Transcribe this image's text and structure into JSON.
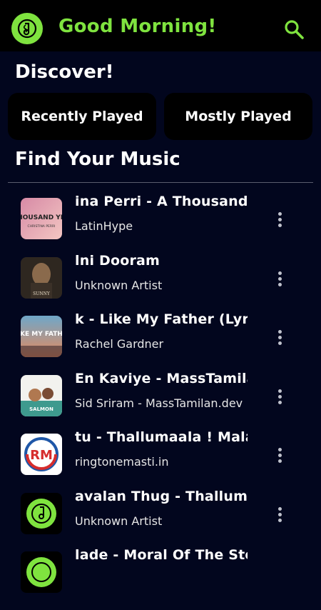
{
  "header": {
    "greeting": "Good Morning!",
    "logo_icon": "music-note-logo-icon",
    "search_icon": "search-icon",
    "accent_color": "#7fe33f"
  },
  "discover": {
    "heading": "Discover!",
    "tabs": [
      {
        "label": "Recently Played"
      },
      {
        "label": "Mostly Played"
      }
    ]
  },
  "library": {
    "heading": "Find Your Music",
    "songs": [
      {
        "title": "ina Perri - A Thousand Y",
        "artist": "LatinHype",
        "thumb_text": "THOUSAND YEA",
        "thumb_subtext": "CHRISTINA PERRI"
      },
      {
        "title": "lni Dooram",
        "artist": "Unknown Artist",
        "thumb_text": "SUNNY"
      },
      {
        "title": "k  - Like My Father (Lyric",
        "artist": "Rachel Gardner",
        "thumb_text": "KE MY FATH"
      },
      {
        "title": "En Kaviye - MassTamila",
        "artist": "Sid Sriram - MassTamilan.dev",
        "thumb_text": "SALMON"
      },
      {
        "title": "tu - Thallumaala ! Malay",
        "artist": "ringtonemasti.in",
        "thumb_text": "RM"
      },
      {
        "title": "avalan Thug - Thallumal",
        "artist": "Unknown Artist"
      },
      {
        "title": "lade - Moral Of The Stor",
        "artist": ""
      }
    ]
  }
}
